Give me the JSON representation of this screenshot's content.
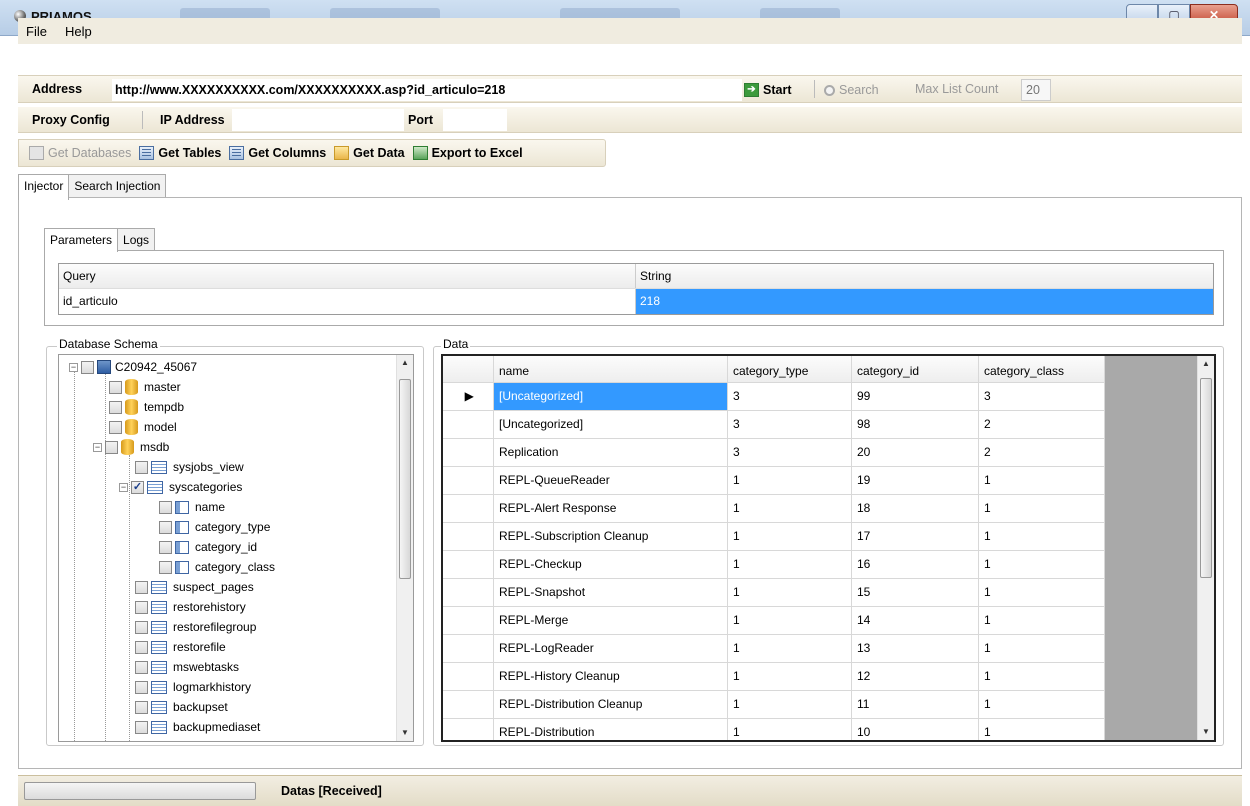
{
  "window": {
    "title": "PRIAMOS"
  },
  "menu": {
    "items": [
      "File",
      "Help"
    ]
  },
  "address": {
    "label": "Address",
    "url": "http://www.XXXXXXXXXX.com/XXXXXXXXXX.asp?id_articulo=218",
    "start_label": "Start",
    "search_label": "Search",
    "max_list_label": "Max List Count",
    "max_list_value": "20"
  },
  "proxy": {
    "config_label": "Proxy Config",
    "ip_label": "IP Address",
    "port_label": "Port"
  },
  "toolbar": {
    "get_databases": "Get Databases",
    "get_tables": "Get Tables",
    "get_columns": "Get Columns",
    "get_data": "Get Data",
    "export_excel": "Export to Excel"
  },
  "main_tabs": [
    "Injector",
    "Search Injection"
  ],
  "param_tabs": [
    "Parameters",
    "Logs"
  ],
  "params": {
    "headers": [
      "Query",
      "String"
    ],
    "rows": [
      [
        "id_articulo",
        "218"
      ]
    ]
  },
  "schema": {
    "label": "Database Schema",
    "nodes": [
      {
        "text": "C20942_45067"
      },
      {
        "text": "master"
      },
      {
        "text": "tempdb"
      },
      {
        "text": "model"
      },
      {
        "text": "msdb"
      },
      {
        "text": "sysjobs_view"
      },
      {
        "text": "syscategories",
        "checked": "✓"
      },
      {
        "text": "name"
      },
      {
        "text": "category_type"
      },
      {
        "text": "category_id"
      },
      {
        "text": "category_class"
      },
      {
        "text": "suspect_pages"
      },
      {
        "text": "restorehistory"
      },
      {
        "text": "restorefilegroup"
      },
      {
        "text": "restorefile"
      },
      {
        "text": "mswebtasks"
      },
      {
        "text": "logmarkhistory"
      },
      {
        "text": "backupset"
      },
      {
        "text": "backupmediaset"
      }
    ]
  },
  "data": {
    "label": "Data",
    "columns": [
      "name",
      "category_type",
      "category_id",
      "category_class"
    ],
    "rows": [
      [
        "[Uncategorized]",
        "3",
        "99",
        "3"
      ],
      [
        "[Uncategorized]",
        "3",
        "98",
        "2"
      ],
      [
        "Replication",
        "3",
        "20",
        "2"
      ],
      [
        "REPL-QueueReader",
        "1",
        "19",
        "1"
      ],
      [
        "REPL-Alert Response",
        "1",
        "18",
        "1"
      ],
      [
        "REPL-Subscription Cleanup",
        "1",
        "17",
        "1"
      ],
      [
        "REPL-Checkup",
        "1",
        "16",
        "1"
      ],
      [
        "REPL-Snapshot",
        "1",
        "15",
        "1"
      ],
      [
        "REPL-Merge",
        "1",
        "14",
        "1"
      ],
      [
        "REPL-LogReader",
        "1",
        "13",
        "1"
      ],
      [
        "REPL-History Cleanup",
        "1",
        "12",
        "1"
      ],
      [
        "REPL-Distribution Cleanup",
        "1",
        "11",
        "1"
      ],
      [
        "REPL-Distribution",
        "1",
        "10",
        "1"
      ]
    ]
  },
  "status": {
    "text": "Datas [Received]"
  }
}
